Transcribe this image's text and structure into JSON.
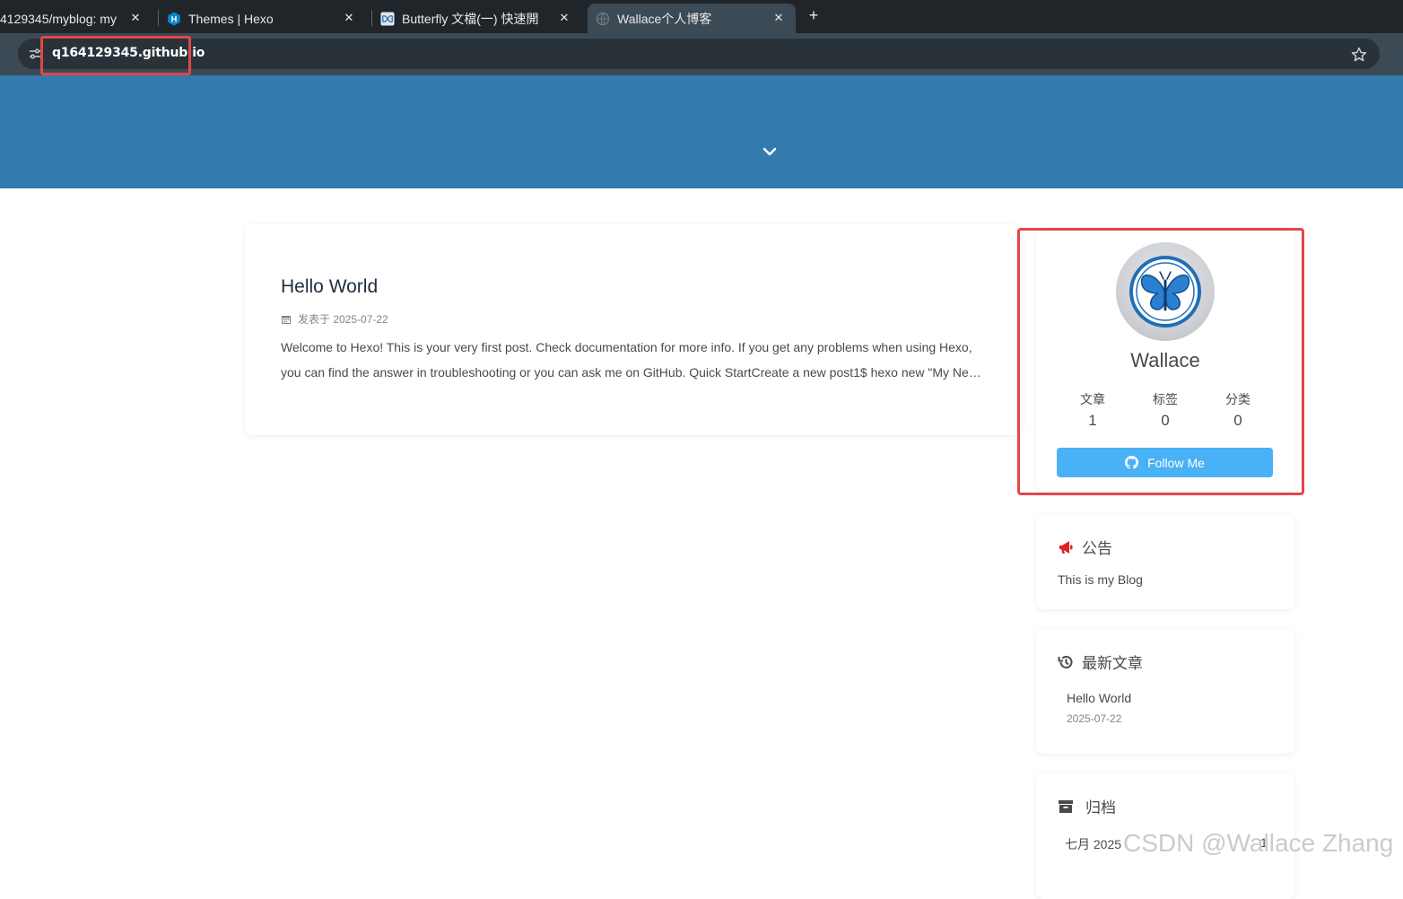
{
  "browser": {
    "tabs": [
      {
        "title": "4129345/myblog: my",
        "active": false
      },
      {
        "title": "Themes | Hexo",
        "active": false
      },
      {
        "title": "Butterfly 文檔(一) 快速開",
        "active": false
      },
      {
        "title": "Wallace个人博客",
        "active": true
      }
    ],
    "new_tab": "+",
    "close_glyph": "✕",
    "url": "q164129345.github.io"
  },
  "colors": {
    "header": "#337aaf",
    "follow_button": "#49b1f5",
    "highlight_box": "#e04848",
    "announcement_icon": "#e02020"
  },
  "post": {
    "title": "Hello World",
    "meta_icon": "calendar-icon",
    "meta": "发表于 2025-07-22",
    "excerpt": "Welcome to Hexo! This is your very first post. Check documentation for more info. If you get any problems when using Hexo, you can find the answer in troubleshooting or you can ask me on GitHub. Quick StartCreate a new post1$ hexo new \"My Ne…"
  },
  "author": {
    "name": "Wallace",
    "stats": [
      {
        "label": "文章",
        "value": "1"
      },
      {
        "label": "标签",
        "value": "0"
      },
      {
        "label": "分类",
        "value": "0"
      }
    ],
    "follow_label": "Follow Me"
  },
  "announcement": {
    "title": "公告",
    "text": "This is my Blog"
  },
  "recent": {
    "title": "最新文章",
    "items": [
      {
        "title": "Hello World",
        "date": "2025-07-22"
      }
    ]
  },
  "archive": {
    "title": "归档",
    "items": [
      {
        "month": "七月 2025",
        "count": "1"
      }
    ]
  },
  "watermark": "CSDN @Wallace Zhang"
}
